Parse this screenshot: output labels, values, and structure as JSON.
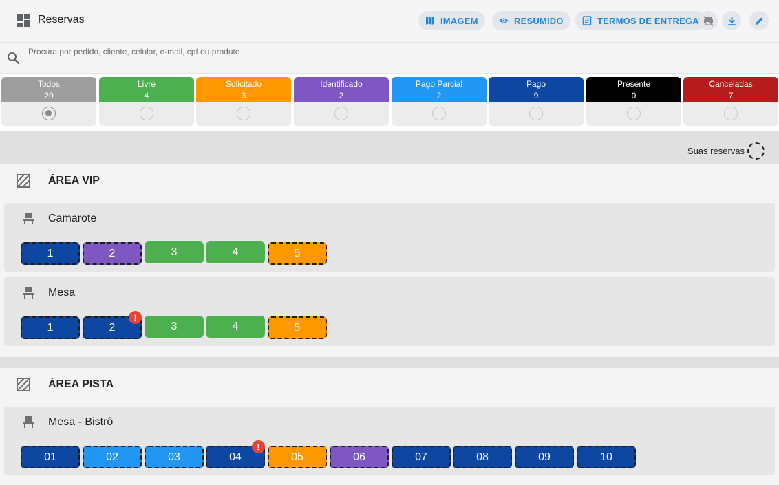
{
  "header": {
    "title": "Reservas",
    "buttons": {
      "imagem": "IMAGEM",
      "resumido": "RESUMIDO",
      "termos": "TERMOS DE ENTREGA"
    },
    "icons": [
      "dashboard-icon",
      "map-icon",
      "eye-icon",
      "document-icon",
      "print-off-icon",
      "download-icon",
      "edit-icon"
    ]
  },
  "search": {
    "placeholder": "Procura por pedido, cliente, celular, e-mail, cpf ou produto",
    "value": ""
  },
  "colors": {
    "todos": "#9e9e9e",
    "livre": "#4caf50",
    "solicitado": "#ff9800",
    "identificado": "#7e57c2",
    "pago_parcial": "#2196f3",
    "pago": "#0d47a1",
    "presente": "#000000",
    "canceladas": "#b71c1c",
    "accent": "#1e88e5",
    "alert": "#ea4335"
  },
  "filters": [
    {
      "key": "todos",
      "label": "Todos",
      "count": "20",
      "selected": true
    },
    {
      "key": "livre",
      "label": "Livre",
      "count": "4",
      "selected": false
    },
    {
      "key": "solicitado",
      "label": "Solicitado",
      "count": "3",
      "selected": false
    },
    {
      "key": "identificado",
      "label": "Identificado",
      "count": "2",
      "selected": false
    },
    {
      "key": "pago_parcial",
      "label": "Pago Parcial",
      "count": "2",
      "selected": false
    },
    {
      "key": "pago",
      "label": "Pago",
      "count": "9",
      "selected": false
    },
    {
      "key": "presente",
      "label": "Presente",
      "count": "0",
      "selected": false
    },
    {
      "key": "canceladas",
      "label": "Canceladas",
      "count": "7",
      "selected": false
    }
  ],
  "legend": {
    "label": "Suas reservas"
  },
  "areas": [
    {
      "name": "ÁREA VIP",
      "sectors": [
        {
          "name": "Camarote",
          "seats": [
            {
              "label": "1",
              "status": "pago",
              "mine": true,
              "alert": false
            },
            {
              "label": "2",
              "status": "identificado",
              "mine": true,
              "alert": false
            },
            {
              "label": "3",
              "status": "livre",
              "mine": false,
              "alert": false
            },
            {
              "label": "4",
              "status": "livre",
              "mine": false,
              "alert": false
            },
            {
              "label": "5",
              "status": "solicitado",
              "mine": true,
              "alert": false
            }
          ]
        },
        {
          "name": "Mesa",
          "seats": [
            {
              "label": "1",
              "status": "pago",
              "mine": true,
              "alert": false
            },
            {
              "label": "2",
              "status": "pago",
              "mine": true,
              "alert": true
            },
            {
              "label": "3",
              "status": "livre",
              "mine": false,
              "alert": false
            },
            {
              "label": "4",
              "status": "livre",
              "mine": false,
              "alert": false
            },
            {
              "label": "5",
              "status": "solicitado",
              "mine": true,
              "alert": false
            }
          ]
        }
      ]
    },
    {
      "name": "ÁREA PISTA",
      "sectors": [
        {
          "name": "Mesa - Bistrô",
          "seats": [
            {
              "label": "01",
              "status": "pago",
              "mine": true,
              "alert": false
            },
            {
              "label": "02",
              "status": "pago_parcial",
              "mine": true,
              "alert": false
            },
            {
              "label": "03",
              "status": "pago_parcial",
              "mine": true,
              "alert": false
            },
            {
              "label": "04",
              "status": "pago",
              "mine": true,
              "alert": true
            },
            {
              "label": "05",
              "status": "solicitado",
              "mine": true,
              "alert": false
            },
            {
              "label": "06",
              "status": "identificado",
              "mine": true,
              "alert": false
            },
            {
              "label": "07",
              "status": "pago",
              "mine": true,
              "alert": false
            },
            {
              "label": "08",
              "status": "pago",
              "mine": true,
              "alert": false
            },
            {
              "label": "09",
              "status": "pago",
              "mine": true,
              "alert": false
            },
            {
              "label": "10",
              "status": "pago",
              "mine": true,
              "alert": false
            }
          ]
        }
      ]
    }
  ],
  "alert_symbol": "!"
}
